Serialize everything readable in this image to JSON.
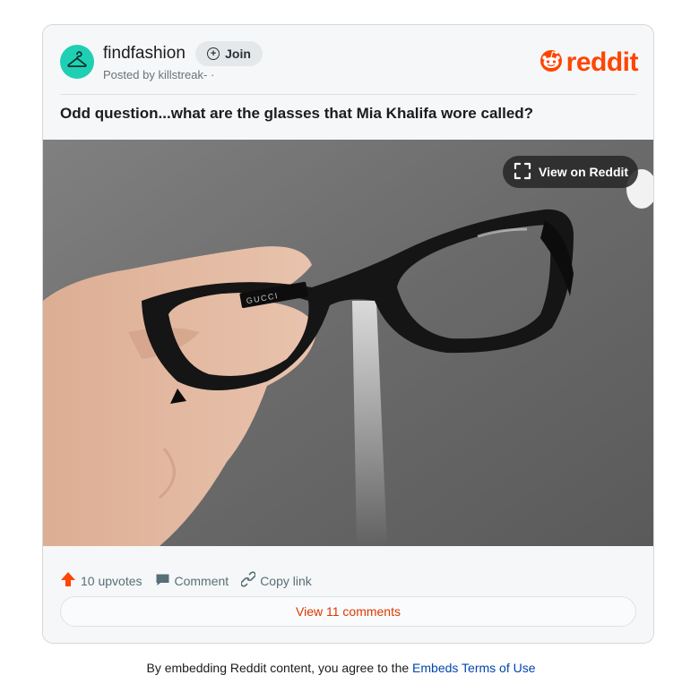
{
  "post": {
    "subreddit": "findfashion",
    "join_label": "Join",
    "posted_prefix": "Posted by ",
    "author": "killstreak-",
    "posted_suffix": " ·",
    "brand": "reddit",
    "title": "Odd question...what are the glasses that Mia Khalifa wore called?"
  },
  "media": {
    "view_label": "View on Reddit",
    "frame_text": "GUCCI"
  },
  "actions": {
    "upvotes": "10 upvotes",
    "comment": "Comment",
    "copy_link": "Copy link",
    "view_comments": "View 11 comments"
  },
  "footer": {
    "disclaimer_prefix": "By embedding Reddit content, you agree to the ",
    "terms_link": "Embeds Terms of Use"
  },
  "colors": {
    "accent": "#ff4500",
    "community_avatar": "#1fcfb3",
    "comments_link": "#d93900",
    "terms_link": "#0045ac"
  },
  "icons": [
    "hanger-icon",
    "plus-circle-icon",
    "reddit-snoo-icon",
    "expand-icon",
    "upvote-arrow-icon",
    "comment-bubble-icon",
    "link-icon"
  ]
}
